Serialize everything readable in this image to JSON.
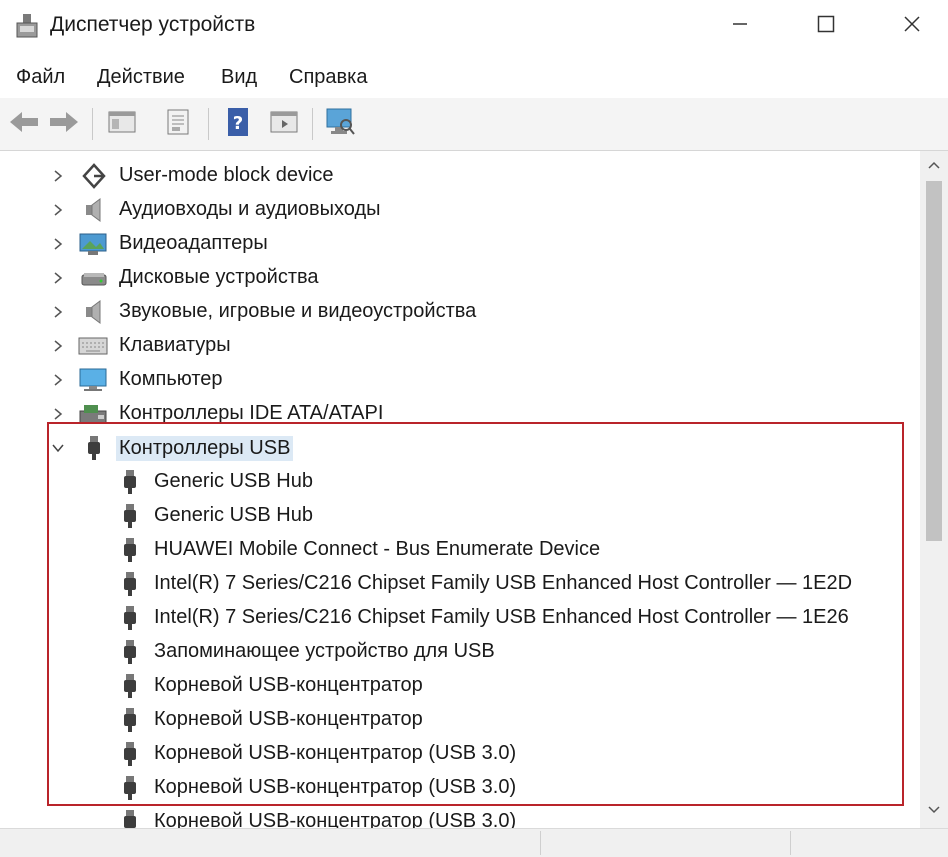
{
  "window": {
    "title": "Диспетчер устройств",
    "icon": "device-manager-icon",
    "controls": [
      "minimize-icon",
      "maximize-icon",
      "close-icon"
    ]
  },
  "menu": [
    "Файл",
    "Действие",
    "Вид",
    "Справка"
  ],
  "toolbar": {
    "buttons": [
      "back-arrow-icon",
      "forward-arrow-icon",
      "show-hide-tree-icon",
      "properties-icon",
      "help-icon",
      "action-view-icon",
      "scan-hardware-icon"
    ]
  },
  "tree": {
    "collapsed_categories": [
      {
        "label": "User-mode block device",
        "icon": "block-device-icon"
      },
      {
        "label": "Аудиовходы и аудиовыходы",
        "icon": "speaker-icon"
      },
      {
        "label": "Видеоадаптеры",
        "icon": "display-adapter-icon"
      },
      {
        "label": "Дисковые устройства",
        "icon": "disk-drive-icon"
      },
      {
        "label": "Звуковые, игровые и видеоустройства",
        "icon": "speaker-icon"
      },
      {
        "label": "Клавиатуры",
        "icon": "keyboard-icon"
      },
      {
        "label": "Компьютер",
        "icon": "computer-icon"
      },
      {
        "label": "Контроллеры IDE ATA/ATAPI",
        "icon": "ide-controller-icon"
      }
    ],
    "expanded_category": {
      "label": "Контроллеры USB",
      "icon": "usb-icon",
      "selected": true
    },
    "usb_devices": [
      "Generic USB Hub",
      "Generic USB Hub",
      "HUAWEI Mobile Connect - Bus Enumerate Device",
      "Intel(R) 7 Series/C216 Chipset Family USB Enhanced Host Controller — 1E2D",
      "Intel(R) 7 Series/C216 Chipset Family USB Enhanced Host Controller — 1E26",
      "Запоминающее устройство для USB",
      "Корневой USB-концентратор",
      "Корневой USB-концентратор",
      "Корневой USB-концентратор (USB 3.0)",
      "Корневой USB-концентратор (USB 3.0)",
      "Корневой USB-концентратор (USB 3.0)"
    ]
  },
  "colors": {
    "highlight_border": "#b9242a",
    "selection_bg": "#dce9f5"
  }
}
